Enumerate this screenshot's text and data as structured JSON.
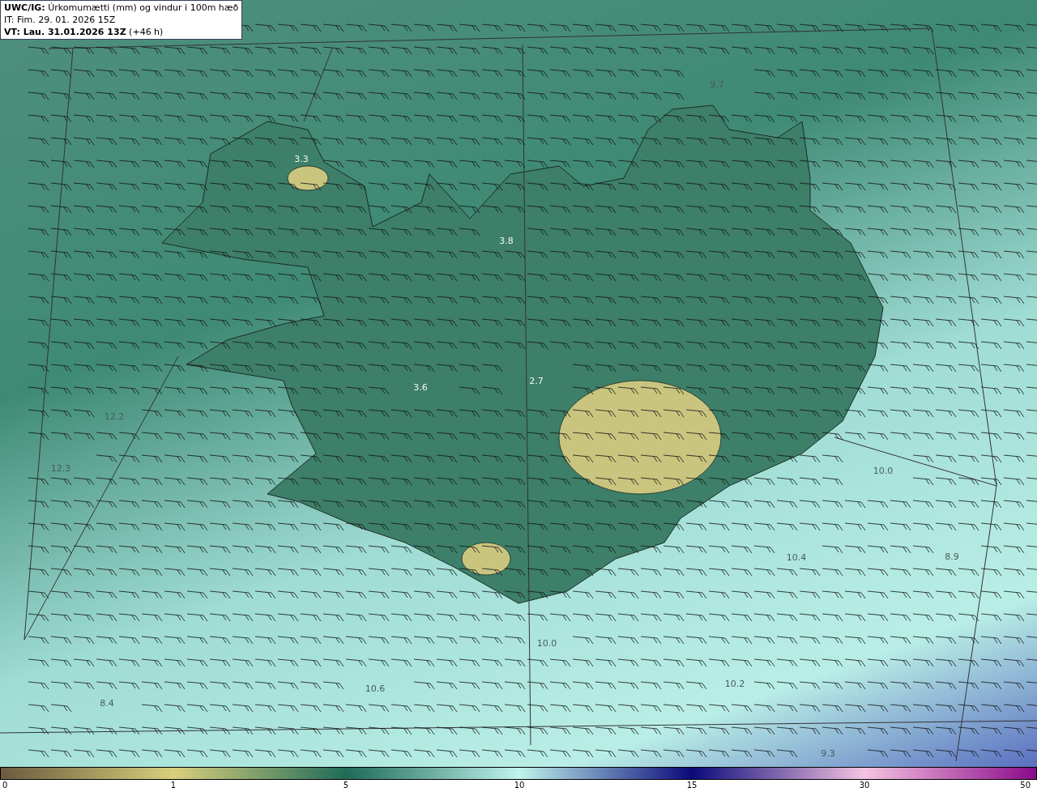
{
  "title_box": {
    "lines": [
      "**UWC/IG:** Úrkomumætti (mm) og vindur i 100m hæð",
      "IT: Fim. 29. 01. 2026 15Z",
      "**VT: Lau. 31.01.2026 13Z** (+46 h)"
    ]
  },
  "map": {
    "value_labels": [
      "9.7",
      "3.3",
      "3.8",
      "2.7",
      "3.6",
      "12.2",
      "12.3",
      "10.0",
      "10.4",
      "8.9",
      "10.0",
      "10.2",
      "10.6",
      "8.4",
      "9.3"
    ]
  },
  "colorbar": {
    "ticks": [
      "0",
      "1",
      "5",
      "10",
      "15",
      "30",
      "50"
    ]
  }
}
